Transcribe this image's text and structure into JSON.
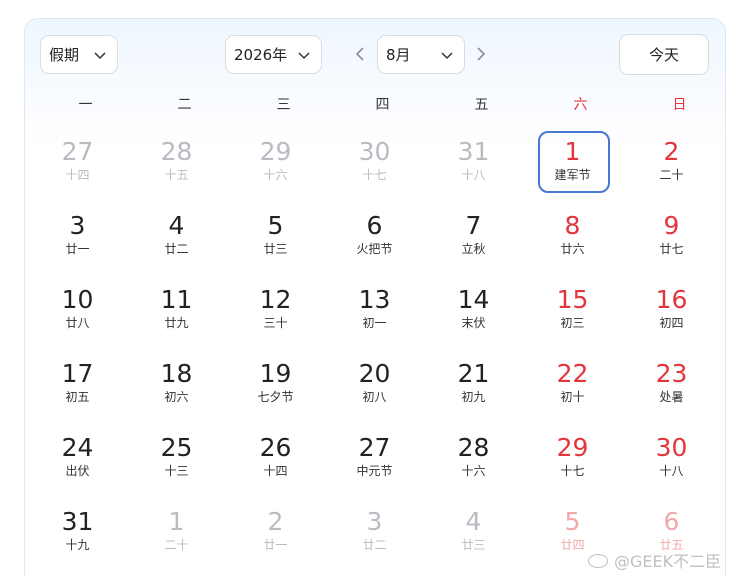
{
  "toolbar": {
    "holiday_select": "假期",
    "year_select": "2026年",
    "month_select": "8月",
    "today_button": "今天"
  },
  "weekdays": [
    "一",
    "二",
    "三",
    "四",
    "五",
    "六",
    "日"
  ],
  "colors": {
    "weekend": "#e3353c",
    "selected_border": "#4a76d4",
    "muted": "#b8bcc2"
  },
  "weeks": [
    [
      {
        "day": "27",
        "lunar": "十四",
        "other": true
      },
      {
        "day": "28",
        "lunar": "十五",
        "other": true
      },
      {
        "day": "29",
        "lunar": "十六",
        "other": true
      },
      {
        "day": "30",
        "lunar": "十七",
        "other": true
      },
      {
        "day": "31",
        "lunar": "十八",
        "other": true
      },
      {
        "day": "1",
        "lunar": "建军节",
        "selected": true
      },
      {
        "day": "2",
        "lunar": "二十"
      }
    ],
    [
      {
        "day": "3",
        "lunar": "廿一"
      },
      {
        "day": "4",
        "lunar": "廿二"
      },
      {
        "day": "5",
        "lunar": "廿三"
      },
      {
        "day": "6",
        "lunar": "火把节"
      },
      {
        "day": "7",
        "lunar": "立秋"
      },
      {
        "day": "8",
        "lunar": "廿六"
      },
      {
        "day": "9",
        "lunar": "廿七"
      }
    ],
    [
      {
        "day": "10",
        "lunar": "廿八"
      },
      {
        "day": "11",
        "lunar": "廿九"
      },
      {
        "day": "12",
        "lunar": "三十"
      },
      {
        "day": "13",
        "lunar": "初一"
      },
      {
        "day": "14",
        "lunar": "末伏"
      },
      {
        "day": "15",
        "lunar": "初三"
      },
      {
        "day": "16",
        "lunar": "初四"
      }
    ],
    [
      {
        "day": "17",
        "lunar": "初五"
      },
      {
        "day": "18",
        "lunar": "初六"
      },
      {
        "day": "19",
        "lunar": "七夕节"
      },
      {
        "day": "20",
        "lunar": "初八"
      },
      {
        "day": "21",
        "lunar": "初九"
      },
      {
        "day": "22",
        "lunar": "初十"
      },
      {
        "day": "23",
        "lunar": "处暑"
      }
    ],
    [
      {
        "day": "24",
        "lunar": "出伏"
      },
      {
        "day": "25",
        "lunar": "十三"
      },
      {
        "day": "26",
        "lunar": "十四"
      },
      {
        "day": "27",
        "lunar": "中元节"
      },
      {
        "day": "28",
        "lunar": "十六"
      },
      {
        "day": "29",
        "lunar": "十七"
      },
      {
        "day": "30",
        "lunar": "十八"
      }
    ],
    [
      {
        "day": "31",
        "lunar": "十九"
      },
      {
        "day": "1",
        "lunar": "二十",
        "other": true
      },
      {
        "day": "2",
        "lunar": "廿一",
        "other": true
      },
      {
        "day": "3",
        "lunar": "廿二",
        "other": true
      },
      {
        "day": "4",
        "lunar": "廿三",
        "other": true
      },
      {
        "day": "5",
        "lunar": "廿四",
        "other": true
      },
      {
        "day": "6",
        "lunar": "廿五",
        "other": true
      }
    ]
  ],
  "watermark": "@GEEK不二臣"
}
